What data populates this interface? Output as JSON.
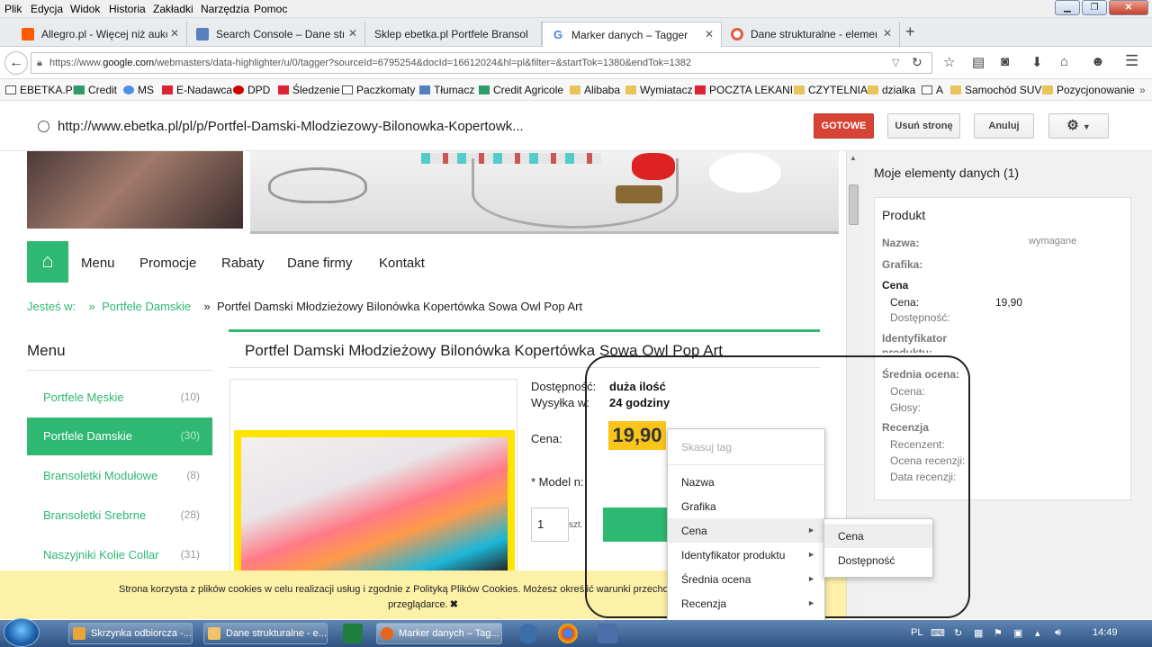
{
  "menubar": {
    "items": [
      "Plik",
      "Edycja",
      "Widok",
      "Historia",
      "Zakładki",
      "Narzędzia",
      "Pomoc"
    ]
  },
  "tabs": [
    {
      "label": "Allegro.pl - Więcej niż aukc...",
      "icon": "allegro-icon"
    },
    {
      "label": "Search Console – Dane stru...",
      "icon": "search-console-icon"
    },
    {
      "label": "Sklep ebetka.pl Portfele Bransol...",
      "icon": "page-icon"
    },
    {
      "label": "Marker danych – Tagger",
      "icon": "google-icon"
    },
    {
      "label": "Dane strukturalne - elemen...",
      "icon": "lifebuoy-icon"
    }
  ],
  "nav": {
    "url_prefix": "https://www.",
    "url_domain": "google.com",
    "url_rest": "/webmasters/data-highlighter/u/0/tagger?sourceId=6795254&docId=16612024&hl=pl&filter=&startTok=1380&endTok=1382"
  },
  "bookmarks": [
    "EBETKA.PL",
    "Credit",
    "MS",
    "E-Nadawca",
    "DPD",
    "Śledzenie",
    "Paczkomaty",
    "Tłumacz",
    "Credit Agricole",
    "Alibaba",
    "Wymiatacz",
    "POCZTA LEKANI",
    "CZYTELNIA",
    "dzialka",
    "A",
    "Samochód SUV",
    "Pozycjonowanie"
  ],
  "tagger": {
    "page_url": "http://www.ebetka.pl/pl/p/Portfel-Damski-Mlodziezowy-Bilonowka-Kopertowk...",
    "done": "GOTOWE",
    "remove_page": "Usuń stronę",
    "cancel": "Anuluj"
  },
  "site": {
    "nav": [
      "Menu",
      "Promocje",
      "Rabaty",
      "Dane firmy",
      "Kontakt"
    ],
    "breadcrumb": {
      "prefix": "Jesteś w:",
      "sep": "»",
      "category": "Portfele Damskie",
      "current": "Portfel Damski Młodzieżowy Bilonówka Kopertówka Sowa Owl Pop Art"
    },
    "menu_title": "Menu",
    "categories": [
      {
        "label": "Portfele Męskie",
        "count": "(10)"
      },
      {
        "label": "Portfele Damskie",
        "count": "(30)"
      },
      {
        "label": "Bransoletki Modułowe",
        "count": "(8)"
      },
      {
        "label": "Bransoletki Srebrne",
        "count": "(28)"
      },
      {
        "label": "Naszyjniki Kolie Collar",
        "count": "(31)"
      }
    ],
    "product_title": "Portfel Damski Młodzieżowy Bilonówka Kopertówka Sowa Owl Pop Art",
    "availability_label": "Dostępność:",
    "availability_value": "duża ilość",
    "shipping_label": "Wysyłka w:",
    "shipping_value": "24 godziny",
    "price_label": "Cena:",
    "price_value": "19,90",
    "model_label": "* Model n:",
    "qty_value": "1",
    "qty_unit": "szt."
  },
  "context_menu": {
    "clear": "Skasuj tag",
    "items": [
      {
        "label": "Nazwa",
        "submenu": false
      },
      {
        "label": "Grafika",
        "submenu": false
      },
      {
        "label": "Cena",
        "submenu": true
      },
      {
        "label": "Identyfikator produktu",
        "submenu": true
      },
      {
        "label": "Średnia ocena",
        "submenu": true
      },
      {
        "label": "Recenzja",
        "submenu": true
      }
    ],
    "submenu": [
      "Cena",
      "Dostępność"
    ]
  },
  "panel": {
    "title": "Moje elementy danych (1)",
    "card_title": "Produkt",
    "name_label": "Nazwa:",
    "name_required": "wymagane",
    "image_label": "Grafika:",
    "price_section": "Cena",
    "price_label": "Cena:",
    "price_value": "19,90",
    "availability_label": "Dostępność:",
    "id_label": "Identyfikator produktu:",
    "rating_section": "Średnia ocena:",
    "rating_label": "Ocena:",
    "votes_label": "Głosy:",
    "review_section": "Recenzja",
    "reviewer_label": "Recenzent:",
    "review_rating_label": "Ocena recenzji:",
    "review_date_label": "Data recenzji:"
  },
  "cookie": {
    "text": "Strona korzysta z plików cookies w celu realizacji usług i zgodnie z Polityką Plików Cookies. Możesz określić warunki przechowywania lub do",
    "text2": "przeglądarce."
  },
  "taskbar": {
    "items": [
      "Skrzynka odbiorcza -...",
      "Dane strukturalne - e...",
      "Marker danych – Tag..."
    ],
    "lang": "PL",
    "time": "14:49"
  }
}
